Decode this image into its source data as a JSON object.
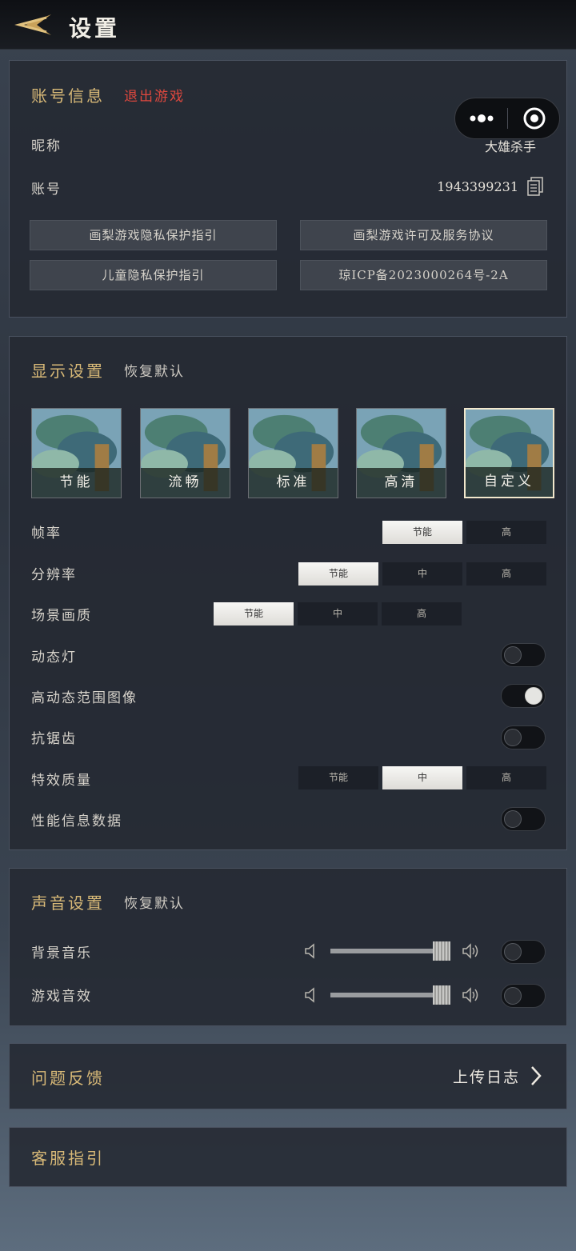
{
  "header": {
    "title": "设置",
    "back_icon": "back-arrow-icon"
  },
  "capsule": {
    "more_icon": "more-dots-icon",
    "close_icon": "target-circle-icon"
  },
  "account": {
    "title": "账号信息",
    "logout": "退出游戏",
    "nickname_label": "昵称",
    "nickname_value": "大雄杀手",
    "account_label": "账号",
    "account_value": "1943399231",
    "copy_icon": "copy-icon",
    "links": [
      "画梨游戏隐私保护指引",
      "画梨游戏许可及服务协议",
      "儿童隐私保护指引",
      "琼ICP备2023000264号-2A"
    ]
  },
  "display": {
    "title": "显示设置",
    "reset": "恢复默认",
    "presets": [
      "节能",
      "流畅",
      "标准",
      "高清",
      "自定义"
    ],
    "selected_preset": "自定义",
    "framerate": {
      "label": "帧率",
      "options": [
        "节能",
        "高"
      ],
      "selected": "节能"
    },
    "resolution": {
      "label": "分辨率",
      "options": [
        "节能",
        "中",
        "高"
      ],
      "selected": "节能"
    },
    "scene_quality": {
      "label": "场景画质",
      "options": [
        "节能",
        "中",
        "高"
      ],
      "selected": "节能"
    },
    "dynamic_light": {
      "label": "动态灯",
      "on": false
    },
    "hdr": {
      "label": "高动态范围图像",
      "on": true
    },
    "antialias": {
      "label": "抗锯齿",
      "on": false
    },
    "effects": {
      "label": "特效质量",
      "options": [
        "节能",
        "中",
        "高"
      ],
      "selected": "中"
    },
    "perf_info": {
      "label": "性能信息数据",
      "on": false
    }
  },
  "sound": {
    "title": "声音设置",
    "reset": "恢复默认",
    "bgm": {
      "label": "背景音乐",
      "volume": 1.0,
      "on": false
    },
    "sfx": {
      "label": "游戏音效",
      "volume": 1.0,
      "on": false
    },
    "icons": {
      "low": "volume-low-icon",
      "high": "volume-high-icon"
    }
  },
  "feedback": {
    "title": "问题反馈",
    "action": "上传日志",
    "icon": "chevron-right-icon"
  },
  "support": {
    "title": "客服指引"
  },
  "colors": {
    "accent_gold": "#d8b977",
    "danger_red": "#e0483e",
    "panel": "#242932"
  }
}
